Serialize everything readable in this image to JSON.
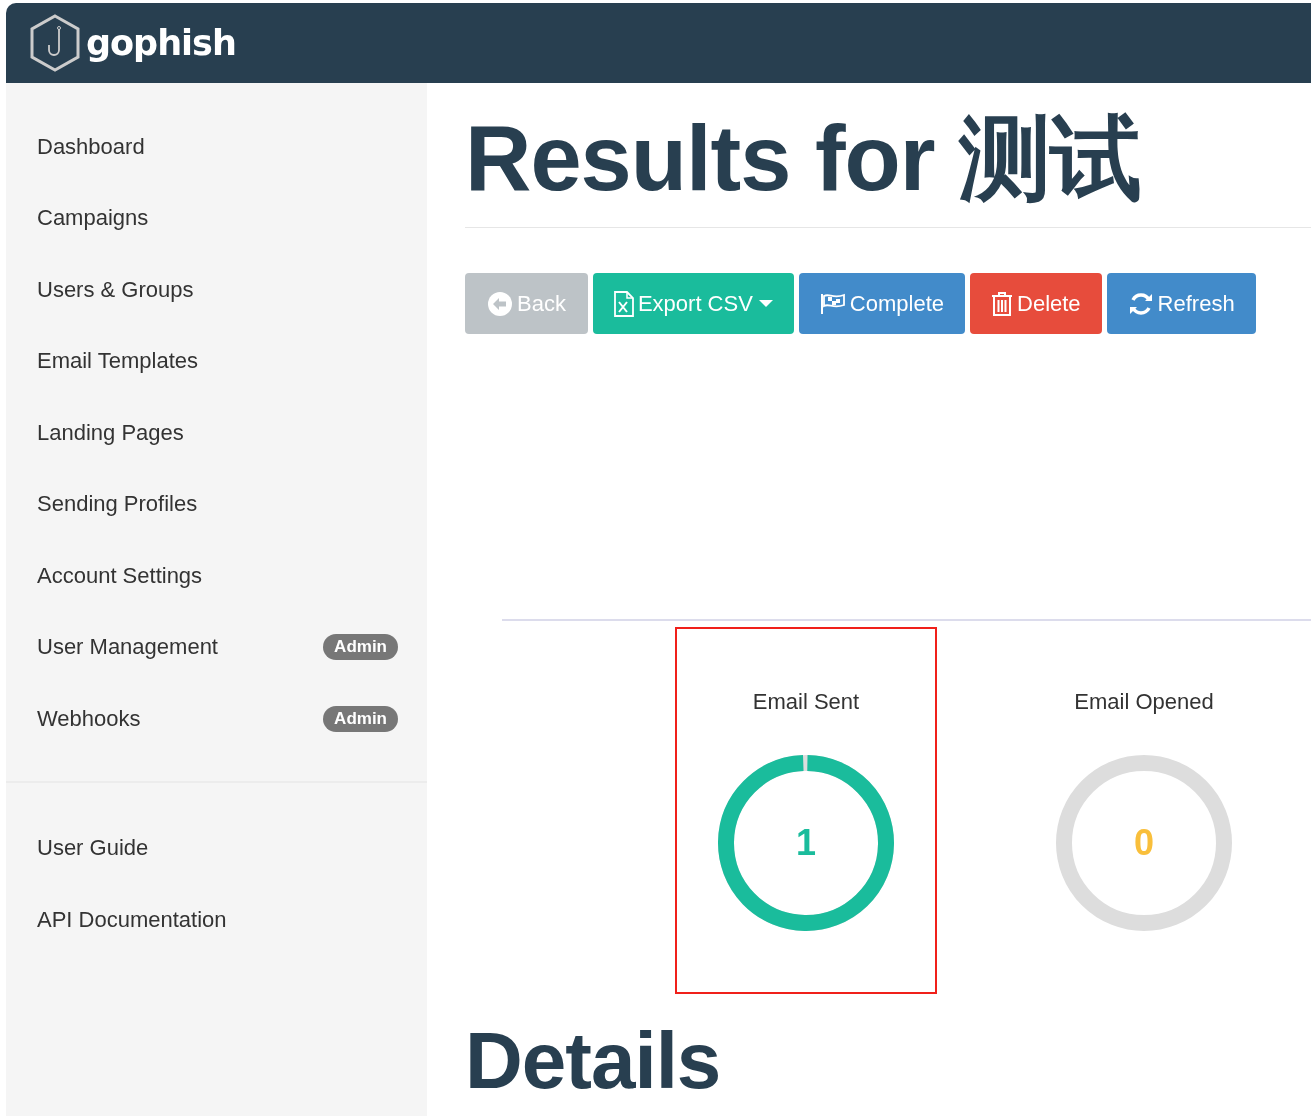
{
  "brand": {
    "name": "gophish"
  },
  "sidebar": {
    "items": [
      {
        "label": "Dashboard"
      },
      {
        "label": "Campaigns"
      },
      {
        "label": "Users & Groups"
      },
      {
        "label": "Email Templates"
      },
      {
        "label": "Landing Pages"
      },
      {
        "label": "Sending Profiles"
      },
      {
        "label": "Account Settings"
      },
      {
        "label": "User Management",
        "badge": "Admin"
      },
      {
        "label": "Webhooks",
        "badge": "Admin"
      }
    ],
    "footer_items": [
      {
        "label": "User Guide"
      },
      {
        "label": "API Documentation"
      }
    ]
  },
  "title": "Results for 测试",
  "buttons": [
    {
      "label": "Back",
      "kind": "back",
      "color": "#bdc3c7"
    },
    {
      "label": "Export CSV",
      "kind": "export",
      "color": "#1abc9c"
    },
    {
      "label": "Complete",
      "kind": "complete",
      "color": "#428bca"
    },
    {
      "label": "Delete",
      "kind": "delete",
      "color": "#e74c3c"
    },
    {
      "label": "Refresh",
      "kind": "refresh",
      "color": "#428bca"
    }
  ],
  "stats": [
    {
      "label": "Email Sent",
      "value": "1",
      "filled": true,
      "color": "#1abc9c",
      "highlighted": true
    },
    {
      "label": "Email Opened",
      "value": "0",
      "filled": false,
      "color": "#f9bf3b",
      "highlighted": false
    }
  ],
  "details_heading": "Details"
}
